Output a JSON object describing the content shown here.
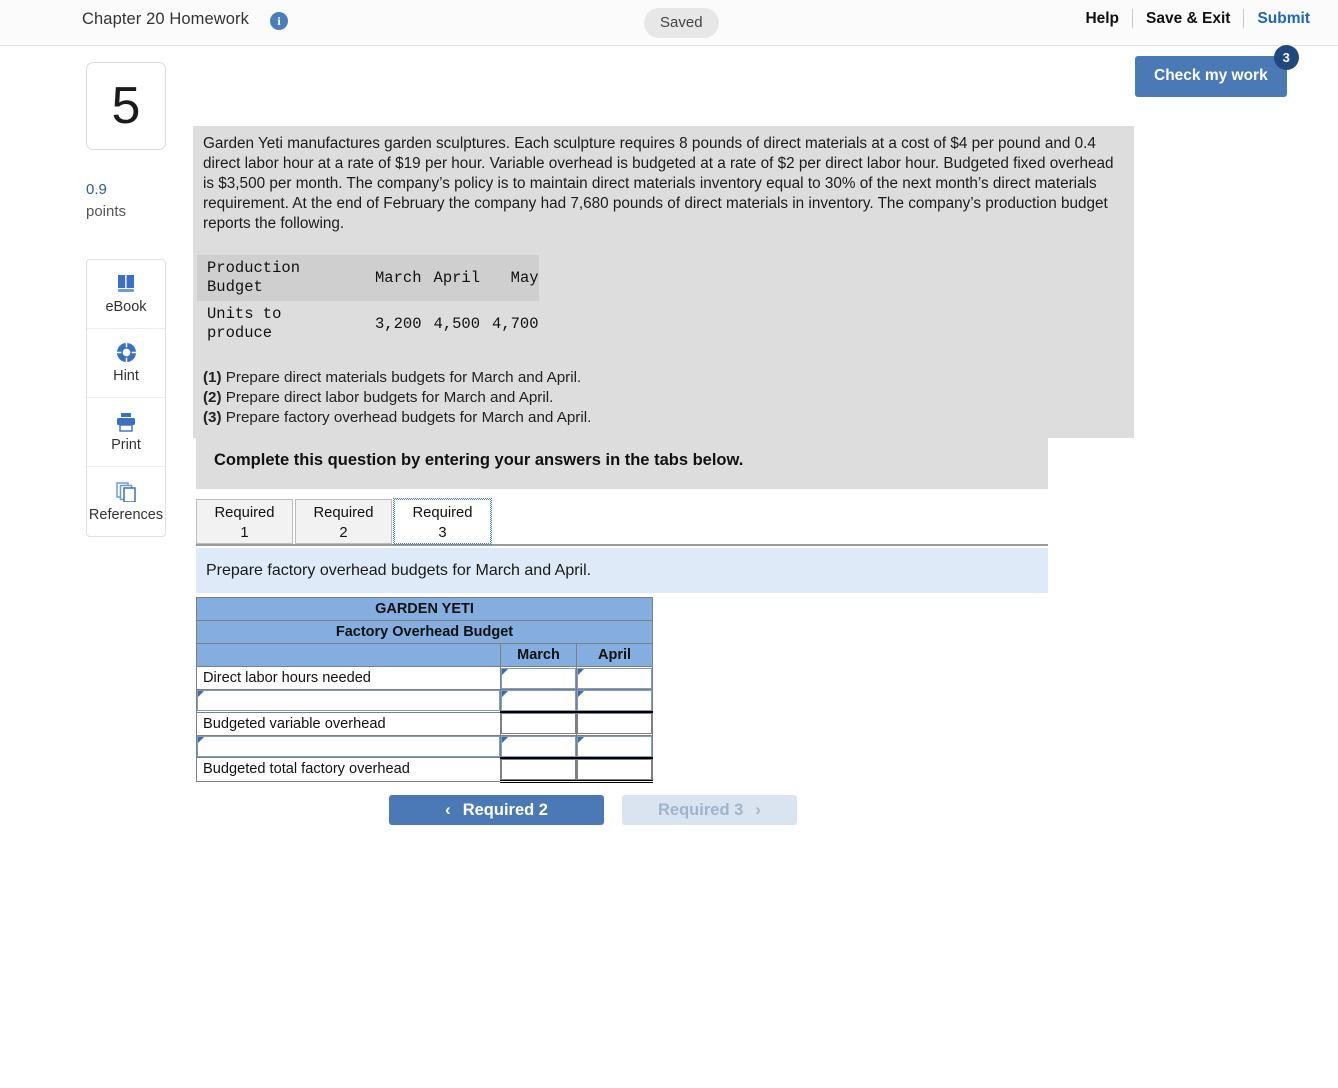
{
  "topbar": {
    "title": "Chapter 20 Homework",
    "info_icon": "info-icon",
    "saved_label": "Saved",
    "help_label": "Help",
    "save_exit_label": "Save & Exit",
    "submit_label": "Submit"
  },
  "check_my_work": {
    "label": "Check my work",
    "badge_count": "3"
  },
  "sidebar": {
    "question_number": "5",
    "points_value": "0.9",
    "points_label": "points",
    "tools": [
      {
        "label": "eBook",
        "icon": "book-icon"
      },
      {
        "label": "Hint",
        "icon": "lifebuoy-icon"
      },
      {
        "label": "Print",
        "icon": "printer-icon"
      },
      {
        "label": "References",
        "icon": "copy-pages-icon"
      }
    ]
  },
  "question": {
    "body": "Garden Yeti manufactures garden sculptures. Each sculpture requires 8 pounds of direct materials at a cost of $4 per pound and 0.4 direct labor hour at a rate of $19 per hour. Variable overhead is budgeted at a rate of $2 per direct labor hour. Budgeted fixed overhead is $3,500 per month. The company’s policy is to maintain direct materials inventory equal to 30% of the next month’s direct materials requirement. At the end of February the company had 7,680 pounds of direct materials in inventory. The company’s production budget reports the following.",
    "production_budget": {
      "title": "Production Budget",
      "columns": [
        "March",
        "April",
        "May"
      ],
      "row_label": "Units to produce",
      "values": [
        "3,200",
        "4,500",
        "4,700"
      ]
    },
    "requirements": [
      {
        "num": "(1)",
        "text": " Prepare direct materials budgets for March and April."
      },
      {
        "num": "(2)",
        "text": " Prepare direct labor budgets for March and April."
      },
      {
        "num": "(3)",
        "text": " Prepare factory overhead budgets for March and April."
      }
    ]
  },
  "answer_area": {
    "complete_banner": "Complete this question by entering your answers in the tabs below.",
    "tabs": [
      {
        "line1": "Required",
        "line2": "1",
        "active": false
      },
      {
        "line1": "Required",
        "line2": "2",
        "active": false
      },
      {
        "line1": "Required",
        "line2": "3",
        "active": true
      }
    ],
    "tab_prompt": "Prepare factory overhead budgets for March and April.",
    "table": {
      "company": "GARDEN YETI",
      "title": "Factory Overhead Budget",
      "col_blank": "",
      "col_march": "March",
      "col_april": "April",
      "rows": [
        {
          "label": "Direct labor hours needed",
          "label_editable": false,
          "march": "",
          "april": "",
          "style": "input"
        },
        {
          "label": "",
          "label_editable": true,
          "march": "",
          "april": "",
          "style": "input"
        },
        {
          "label": "Budgeted variable overhead",
          "label_editable": false,
          "march": "",
          "april": "",
          "style": "total-top"
        },
        {
          "label": "",
          "label_editable": true,
          "march": "",
          "april": "",
          "style": "input"
        },
        {
          "label": "Budgeted total factory overhead",
          "label_editable": false,
          "march": "",
          "april": "",
          "style": "grand-total"
        }
      ]
    },
    "nav": {
      "prev_label": "Required 2",
      "prev_chevron": "‹",
      "next_label": "Required 3",
      "next_chevron": "›"
    }
  },
  "colors": {
    "accent_blue": "#4a79b5",
    "badge_navy": "#21477f",
    "table_header_blue": "#84aee0",
    "panel_gray": "#dddddd",
    "prompt_blue": "#deeaf7",
    "link_blue": "#1a66c2"
  }
}
